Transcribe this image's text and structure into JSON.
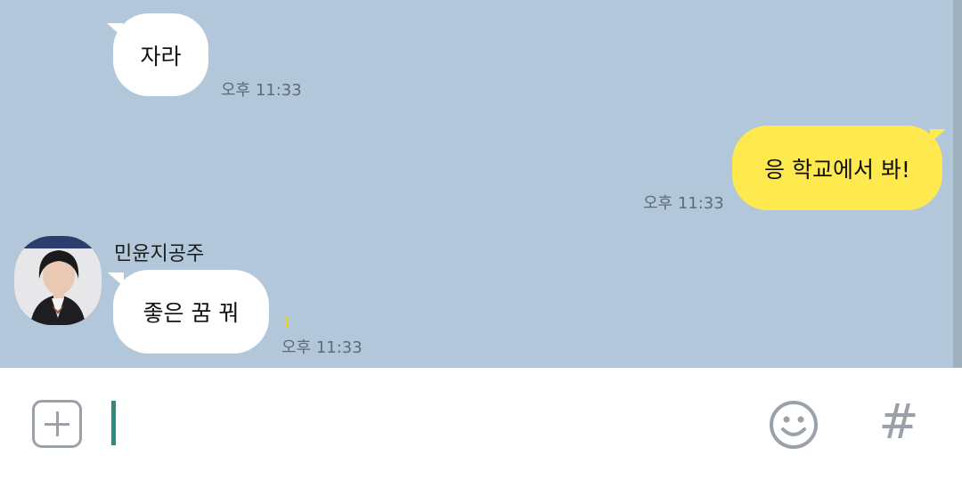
{
  "messages": [
    {
      "direction": "incoming",
      "text": "자라",
      "time": "오후 11:33"
    },
    {
      "direction": "outgoing",
      "text": "응 학교에서 봐!",
      "time": "오후 11:33"
    },
    {
      "direction": "incoming",
      "sender": "민윤지공주",
      "text": "좋은 꿈 꿔",
      "time": "오후 11:33",
      "unread_count": "1"
    }
  ],
  "input_bar": {
    "plus_icon": "plus-icon",
    "emoji_icon": "smiley-icon",
    "hashtag_icon": "hashtag-icon",
    "hashtag_glyph": "#"
  },
  "colors": {
    "chat_background": "#b2c7d9",
    "incoming_bubble": "#ffffff",
    "outgoing_bubble": "#fee94e",
    "cursor": "#2a8c7c"
  }
}
